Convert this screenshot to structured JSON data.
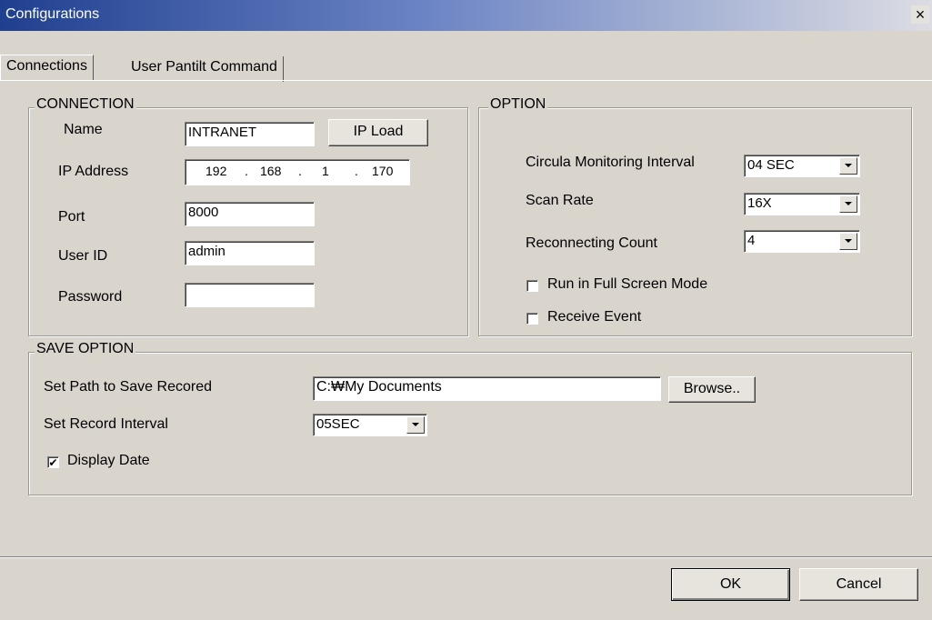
{
  "window": {
    "title": "Configurations",
    "close_label": "×"
  },
  "tabs": [
    {
      "label": "Connections"
    },
    {
      "label": "User Pantilt Command"
    }
  ],
  "connection": {
    "legend": "CONNECTION",
    "name_label": "Name",
    "name_value": "INTRANET",
    "ip_load_label": "IP Load",
    "ip_label": "IP Address",
    "ip_octets": [
      "192",
      "168",
      "1",
      "170"
    ],
    "port_label": "Port",
    "port_value": "8000",
    "userid_label": "User ID",
    "userid_value": "admin",
    "password_label": "Password",
    "password_value": ""
  },
  "option": {
    "legend": "OPTION",
    "circula_label": "Circula Monitoring Interval",
    "circula_value": "04 SEC",
    "scan_label": "Scan Rate",
    "scan_value": "16X",
    "reconnect_label": "Reconnecting Count",
    "reconnect_value": "4",
    "fullscreen_label": "Run in Full Screen Mode",
    "fullscreen_checked": false,
    "receive_label": "Receive Event",
    "receive_checked": false
  },
  "save_option": {
    "legend": "SAVE OPTION",
    "path_label": "Set Path to Save Recored",
    "path_value": "C:₩My Documents",
    "browse_label": "Browse..",
    "interval_label": "Set Record Interval",
    "interval_value": "05SEC",
    "display_date_label": "Display Date",
    "display_date_checked": true,
    "check_mark": "✔"
  },
  "footer": {
    "ok_label": "OK",
    "cancel_label": "Cancel"
  }
}
